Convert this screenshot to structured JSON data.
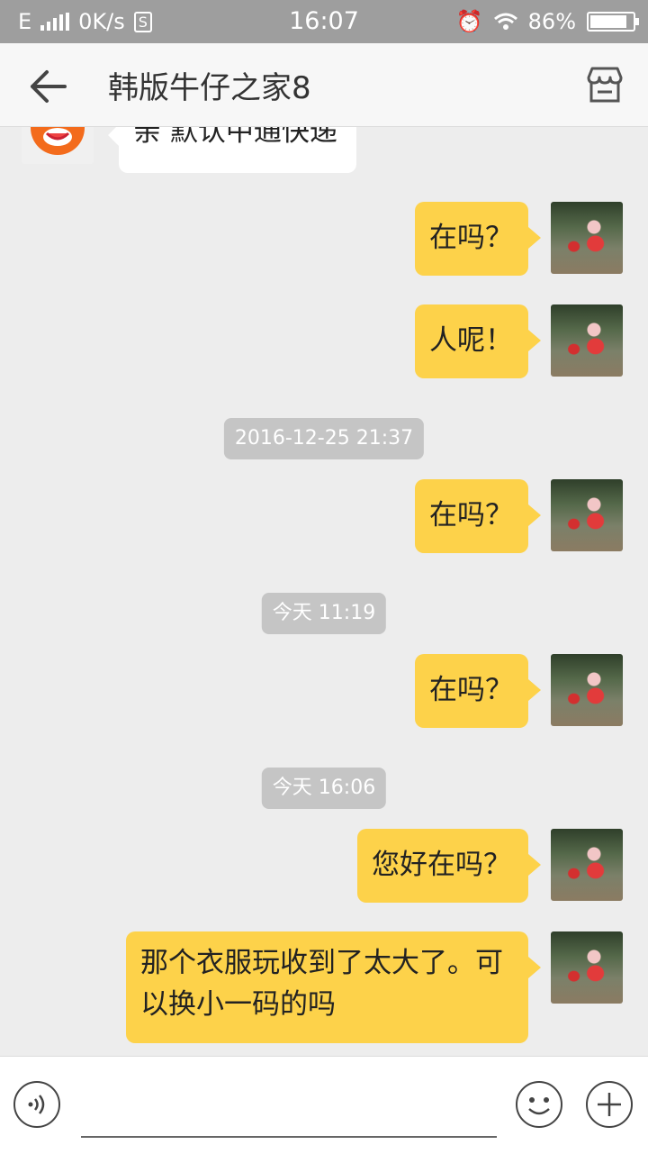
{
  "status_bar": {
    "network": "E",
    "speed": "0K/s",
    "time": "16:07",
    "battery": "86%",
    "battery_level": 0.86
  },
  "header": {
    "title": "韩版牛仔之家8"
  },
  "messages": [
    {
      "type": "shop",
      "text": "亲 默认中通快递"
    },
    {
      "type": "user",
      "text": "在吗？"
    },
    {
      "type": "user",
      "text": "人呢！"
    },
    {
      "type": "time",
      "text": "2016-12-25 21:37"
    },
    {
      "type": "user",
      "text": "在吗？"
    },
    {
      "type": "time",
      "text": "今天 11:19"
    },
    {
      "type": "user",
      "text": "在吗？"
    },
    {
      "type": "time",
      "text": "今天 16:06"
    },
    {
      "type": "user",
      "text": "您好在吗？"
    },
    {
      "type": "user",
      "text": "那个衣服玩收到了太大了。可以换小一码的吗"
    }
  ],
  "input": {
    "value": ""
  },
  "colors": {
    "bubble": "#fdd24a",
    "background": "#ededed",
    "status_bar": "#9e9e9e"
  }
}
